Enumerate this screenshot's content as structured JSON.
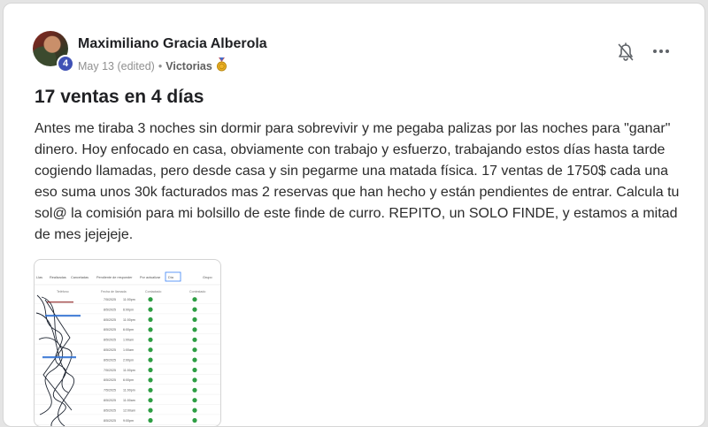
{
  "post": {
    "author": {
      "name": "Maximiliano Gracia Alberola",
      "level": "4"
    },
    "meta": {
      "date": "May 13 (edited)",
      "separator": "•",
      "category": "Victorias",
      "category_icon": "medal-icon"
    },
    "actions": {
      "notify_icon": "bell-off-icon",
      "more_icon": "more-options-icon"
    },
    "title": "17 ventas en 4 días",
    "body": "Antes me tiraba 3 noches sin dormir para sobrevivir y me pegaba palizas por las noches para \"ganar\" dinero. Hoy enfocado en casa, obviamente con trabajo y esfuerzo, trabajando estos días hasta tarde cogiendo llamadas, pero desde casa y sin pegarme una matada física. 17 ventas de 1750$ cada una eso suma unos 30k facturados mas 2 reservas que han hecho y están pendientes de entrar. Calcula tu sol@ la comisión para mi bolsillo de este finde de curro. REPITO, un SOLO FINDE, y estamos a mitad de mes jejejeje.",
    "attachment": {
      "type": "screenshot-image",
      "tabs": [
        "Llas",
        "Realizadas",
        "Canceladas",
        "Pendiente de responder",
        "Por actualizar",
        "Día",
        "Grupo"
      ],
      "columns": [
        "Teléfono",
        "Fecha de llamada",
        "Contactado",
        "Contestado"
      ],
      "rows": [
        [
          "7/5/2025",
          "11:00pm"
        ],
        [
          "8/5/2025",
          "6:00pm"
        ],
        [
          "8/5/2025",
          "11:00pm"
        ],
        [
          "8/5/2025",
          "6:00pm"
        ],
        [
          "8/5/2025",
          "1:00am"
        ],
        [
          "8/5/2025",
          "1:00am"
        ],
        [
          "8/5/2025",
          "2:00pm"
        ],
        [
          "7/5/2025",
          "11:00pm"
        ],
        [
          "8/5/2025",
          "6:00pm"
        ],
        [
          "7/5/2025",
          "11:00pm"
        ],
        [
          "8/5/2025",
          "11:00am"
        ],
        [
          "8/5/2025",
          "12:00am"
        ],
        [
          "8/5/2025",
          "9:00pm"
        ]
      ]
    }
  }
}
